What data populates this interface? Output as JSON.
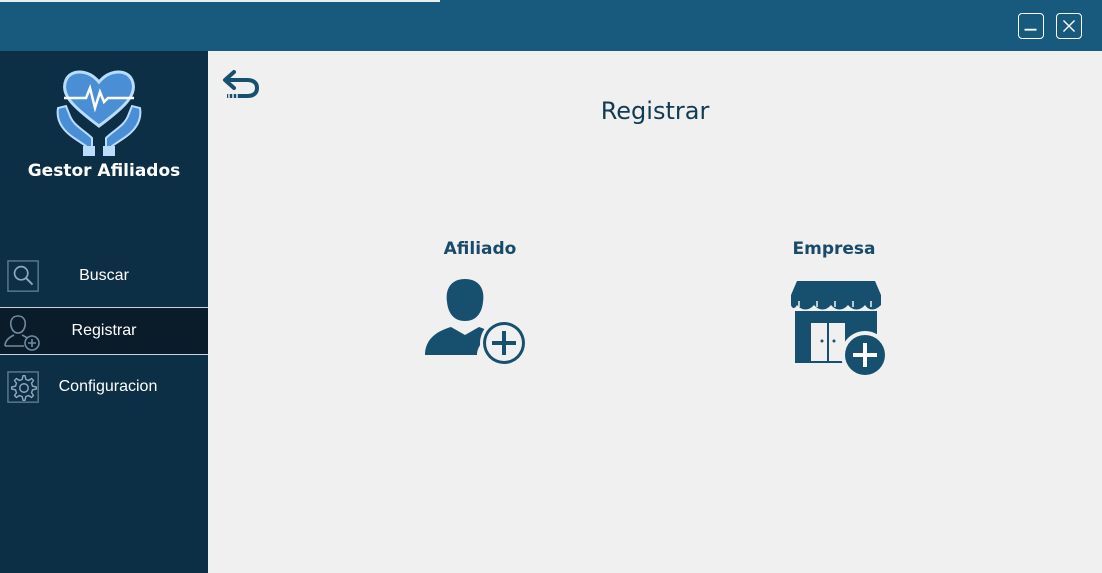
{
  "app": {
    "name": "Gestor Afiliados"
  },
  "window": {
    "minimize_icon": "minimize-icon",
    "close_icon": "close-icon"
  },
  "sidebar": {
    "items": [
      {
        "label": "Buscar",
        "icon": "search-icon"
      },
      {
        "label": "Registrar",
        "icon": "user-add-icon",
        "active": true
      },
      {
        "label": "Configuracion",
        "icon": "gear-icon"
      }
    ]
  },
  "main": {
    "title": "Registrar",
    "back_icon": "back-arrow-icon",
    "options": [
      {
        "label": "Afiliado",
        "icon": "user-plus-icon"
      },
      {
        "label": "Empresa",
        "icon": "store-plus-icon"
      }
    ]
  },
  "colors": {
    "titlebar": "#175a7d",
    "sidebar": "#0d2f45",
    "sidebar_active": "#0a1c29",
    "content_bg": "#f0f0f0",
    "accent": "#1a4a69"
  }
}
